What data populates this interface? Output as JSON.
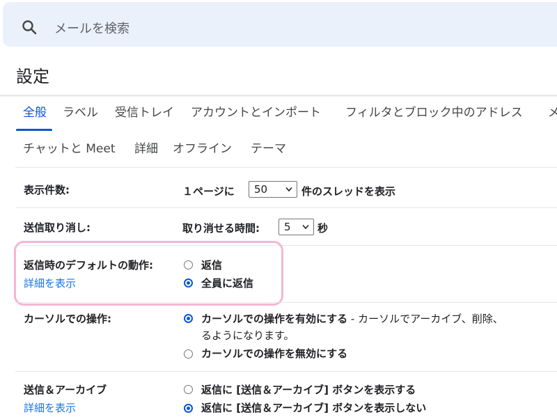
{
  "search": {
    "placeholder": "メールを検索"
  },
  "page_title": "設定",
  "tabs_row1": [
    "全般",
    "ラベル",
    "受信トレイ",
    "アカウントとインポート",
    "フィルタとブロック中のアドレス",
    "メ"
  ],
  "tabs_row2": [
    "チャットと Meet",
    "詳細",
    "オフライン",
    "テーマ"
  ],
  "active_tab": "全般",
  "settings": {
    "display_count": {
      "label": "表示件数:",
      "prefix": "１ページに",
      "value": "50",
      "suffix": "件のスレッドを表示"
    },
    "undo_send": {
      "label": "送信取り消し:",
      "prefix": "取り消せる時間:",
      "value": "5",
      "suffix": "秒"
    },
    "reply_default": {
      "label": "返信時のデフォルトの動作:",
      "link": "詳細を表示",
      "options": [
        "返信",
        "全員に返信"
      ],
      "selected": "全員に返信"
    },
    "cursor_actions": {
      "label": "カーソルでの操作:",
      "option_on": "カーソルでの操作を有効にする",
      "option_on_desc": " - カーソルでアーカイブ、削除、",
      "option_on_desc2": "るようになります。",
      "option_off": "カーソルでの操作を無効にする",
      "selected": "カーソルでの操作を有効にする"
    },
    "send_archive": {
      "label": "送信＆アーカイブ",
      "link": "詳細を表示",
      "options": [
        "返信に [送信＆アーカイブ] ボタンを表示する",
        "返信に [送信＆アーカイブ] ボタンを表示しない"
      ],
      "selected": "返信に [送信＆アーカイブ] ボタンを表示しない"
    }
  },
  "colors": {
    "accent": "#0b57d0",
    "link": "#1a73e8",
    "highlight": "#f3b7d6",
    "search_bg": "#eaf1fb"
  }
}
